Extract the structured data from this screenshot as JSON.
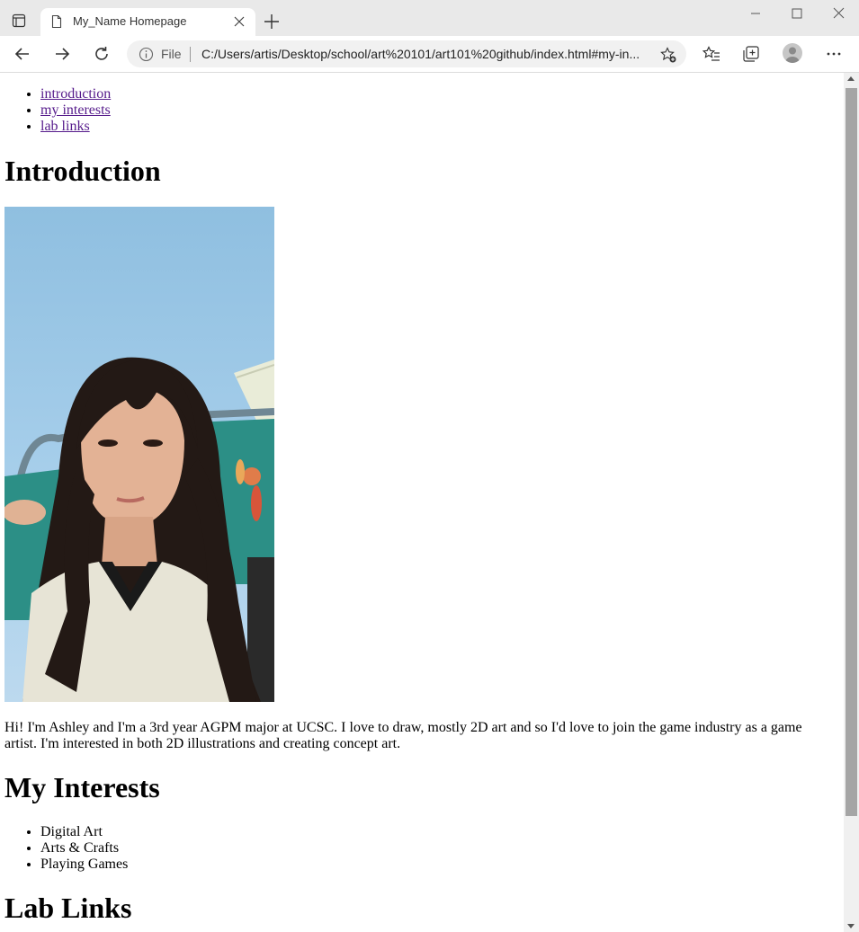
{
  "browser": {
    "tab_title": "My_Name Homepage",
    "address_prefix": "File",
    "url": "C:/Users/artis/Desktop/school/art%20101/art101%20github/index.html#my-in..."
  },
  "page": {
    "nav_links": [
      {
        "label": "introduction"
      },
      {
        "label": "my interests"
      },
      {
        "label": "lab links"
      }
    ],
    "intro_heading": "Introduction",
    "intro_text": "Hi! I'm Ashley and I'm a 3rd year AGPM major at UCSC. I love to draw, mostly 2D art and so I'd love to join the game industry as a game artist. I'm interested in both 2D illustrations and creating concept art.",
    "interests_heading": "My Interests",
    "interests": [
      "Digital Art",
      "Arts & Crafts",
      "Playing Games"
    ],
    "lab_links_heading": "Lab Links"
  },
  "colors": {
    "link_visited": "#551a8b",
    "chrome_bg": "#e9e9e9"
  }
}
